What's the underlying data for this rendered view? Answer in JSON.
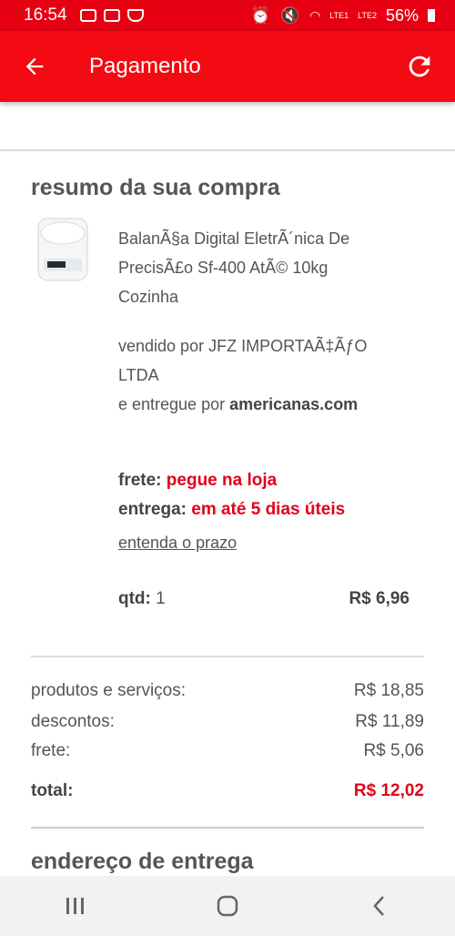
{
  "status": {
    "time": "16:54",
    "battery": "56%",
    "sim1": "LTE1",
    "sim2": "LTE2"
  },
  "appbar": {
    "title": "Pagamento",
    "accent_color": "#f30a12"
  },
  "purchase_summary": {
    "title": "resumo da sua compra",
    "product_name_line1": "BalanÃ§a Digital EletrÃ´nica De",
    "product_name_line2": "PrecisÃ£o Sf-400 AtÃ© 10kg",
    "product_name_line3": "Cozinha",
    "seller_prefix": "vendido por",
    "seller_name_line1": "JFZ IMPORTAÃ‡ÃƒO",
    "seller_name_line2": "LTDA",
    "delivered_prefix": "e entregue por",
    "delivered_by": "americanas.com",
    "frete_label": "frete:",
    "frete_value": "pegue na loja",
    "entrega_label": "entrega:",
    "entrega_value": "em até 5 dias úteis",
    "prazo_link": "entenda o prazo",
    "qtd_label": "qtd:",
    "qtd_value": "1",
    "item_price": "R$ 6,96"
  },
  "totals": {
    "produtos_label": "produtos e serviços:",
    "produtos_value": "R$ 18,85",
    "descontos_label": "descontos:",
    "descontos_value": "R$ 11,89",
    "frete_label": "frete:",
    "frete_value": "R$ 5,06",
    "total_label": "total:",
    "total_value": "R$ 12,02"
  },
  "address": {
    "title": "endereço de entrega"
  },
  "icons": [
    "arrow-back-icon",
    "refresh-icon",
    "product-scale-image",
    "nav-recents-icon",
    "nav-home-icon",
    "nav-back-icon"
  ]
}
